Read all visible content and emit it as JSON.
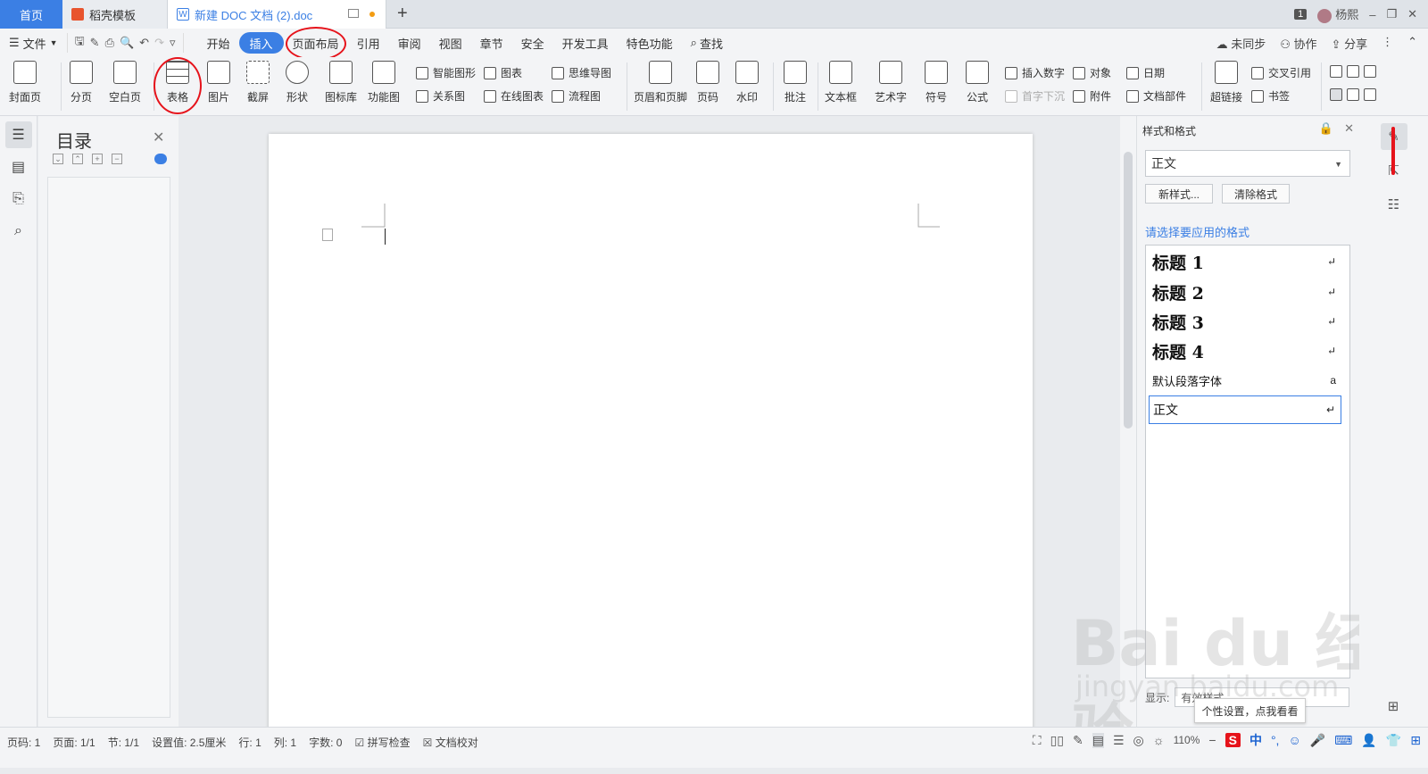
{
  "tabs": {
    "home": "首页",
    "template": "稻壳模板",
    "document": "新建 DOC 文档 (2).doc"
  },
  "titlebar": {
    "window_count": "1",
    "user": "杨熙"
  },
  "menu": {
    "file": "文件",
    "items": [
      "开始",
      "插入",
      "页面布局",
      "引用",
      "审阅",
      "视图",
      "章节",
      "安全",
      "开发工具",
      "特色功能",
      "查找"
    ],
    "active": "插入",
    "right": [
      "未同步",
      "协作",
      "分享"
    ]
  },
  "ribbon": {
    "big": [
      "封面页",
      "分页",
      "空白页",
      "表格",
      "图片",
      "截屏",
      "形状",
      "图标库",
      "功能图",
      "页眉和页脚",
      "页码",
      "水印",
      "批注",
      "文本框",
      "艺术字",
      "符号",
      "公式",
      "超链接"
    ],
    "small": {
      "smart_shape": "智能图形",
      "chart": "图表",
      "mindmap": "思维导图",
      "relation": "关系图",
      "online_chart": "在线图表",
      "flowchart": "流程图",
      "insert_number": "插入数字",
      "object": "对象",
      "date": "日期",
      "drop_cap": "首字下沉",
      "attachment": "附件",
      "doc_parts": "文档部件",
      "cross_ref": "交叉引用",
      "bookmark": "书签"
    }
  },
  "toc": {
    "title": "目录"
  },
  "styles_panel": {
    "title": "样式和格式",
    "current": "正文",
    "new_style": "新样式...",
    "clear_format": "清除格式",
    "prompt": "请选择要应用的格式",
    "items": [
      {
        "label": "标题  1",
        "mark": "↵"
      },
      {
        "label": "标题  2",
        "mark": "↵"
      },
      {
        "label": "标题  3",
        "mark": "↵"
      },
      {
        "label": "标题  4",
        "mark": "↵"
      },
      {
        "label": "默认段落字体",
        "mark": "a"
      },
      {
        "label": "正文",
        "mark": "↵"
      }
    ],
    "show_label": "显示:",
    "show_value": "有效样式",
    "tooltip": "个性设置，点我看看"
  },
  "statusbar": {
    "left": [
      "页码: 1",
      "页面: 1/1",
      "节: 1/1",
      "设置值: 2.5厘米",
      "行: 1",
      "列: 1",
      "字数: 0",
      "拼写检查",
      "文档校对"
    ],
    "zoom": "110%",
    "ime": "S",
    "ime_lang": "中"
  },
  "watermark": {
    "brand": "Bai du 经验",
    "url": "jingyan.baidu.com"
  },
  "colors": {
    "accent": "#3b7fe4",
    "annotation": "#e6131b"
  }
}
